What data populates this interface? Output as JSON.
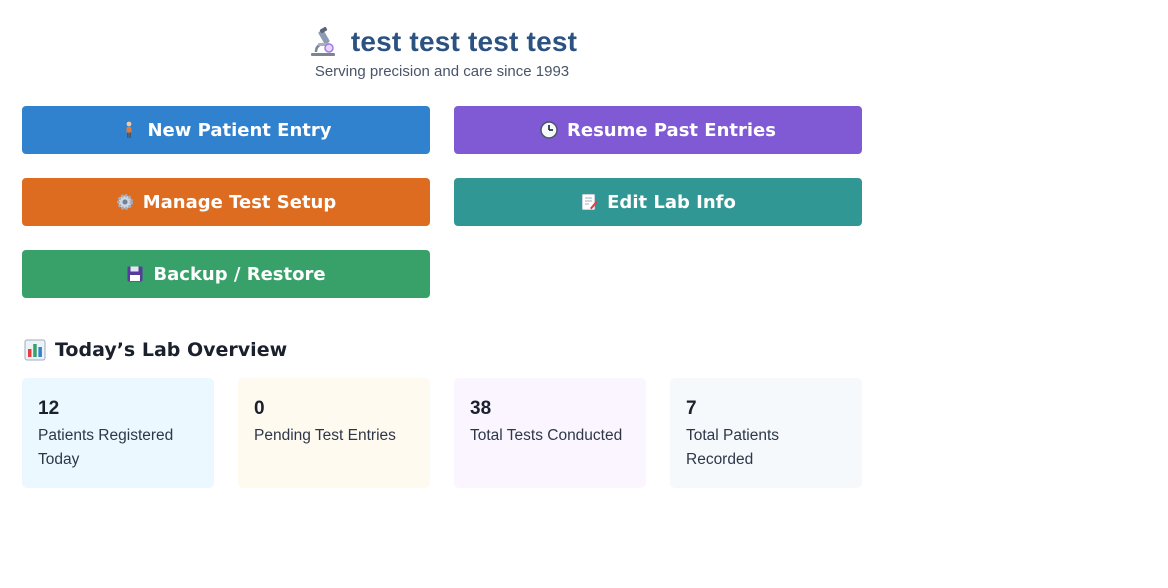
{
  "header": {
    "icon": "microscope-icon",
    "title": "test test test test",
    "subtitle": "Serving precision and care since 1993"
  },
  "actions": [
    {
      "label": "New Patient Entry",
      "icon": "person-icon",
      "color": "#3182ce"
    },
    {
      "label": "Resume Past Entries",
      "icon": "clock-icon",
      "color": "#805ad5"
    },
    {
      "label": "Manage Test Setup",
      "icon": "gear-icon",
      "color": "#dd6b20"
    },
    {
      "label": "Edit Lab Info",
      "icon": "memo-icon",
      "color": "#319795"
    },
    {
      "label": "Backup / Restore",
      "icon": "floppy-disk-icon",
      "color": "#38a169"
    }
  ],
  "overview": {
    "title": "Today’s Lab Overview",
    "icon": "bar-chart-icon",
    "stats": [
      {
        "value": "12",
        "label": "Patients Registered Today",
        "bg": "#ebf8ff"
      },
      {
        "value": "0",
        "label": "Pending Test Entries",
        "bg": "#fffaf0"
      },
      {
        "value": "38",
        "label": "Total Tests Conducted",
        "bg": "#faf5ff"
      },
      {
        "value": "7",
        "label": "Total Patients Recorded",
        "bg": "#f5f9fc"
      }
    ]
  }
}
